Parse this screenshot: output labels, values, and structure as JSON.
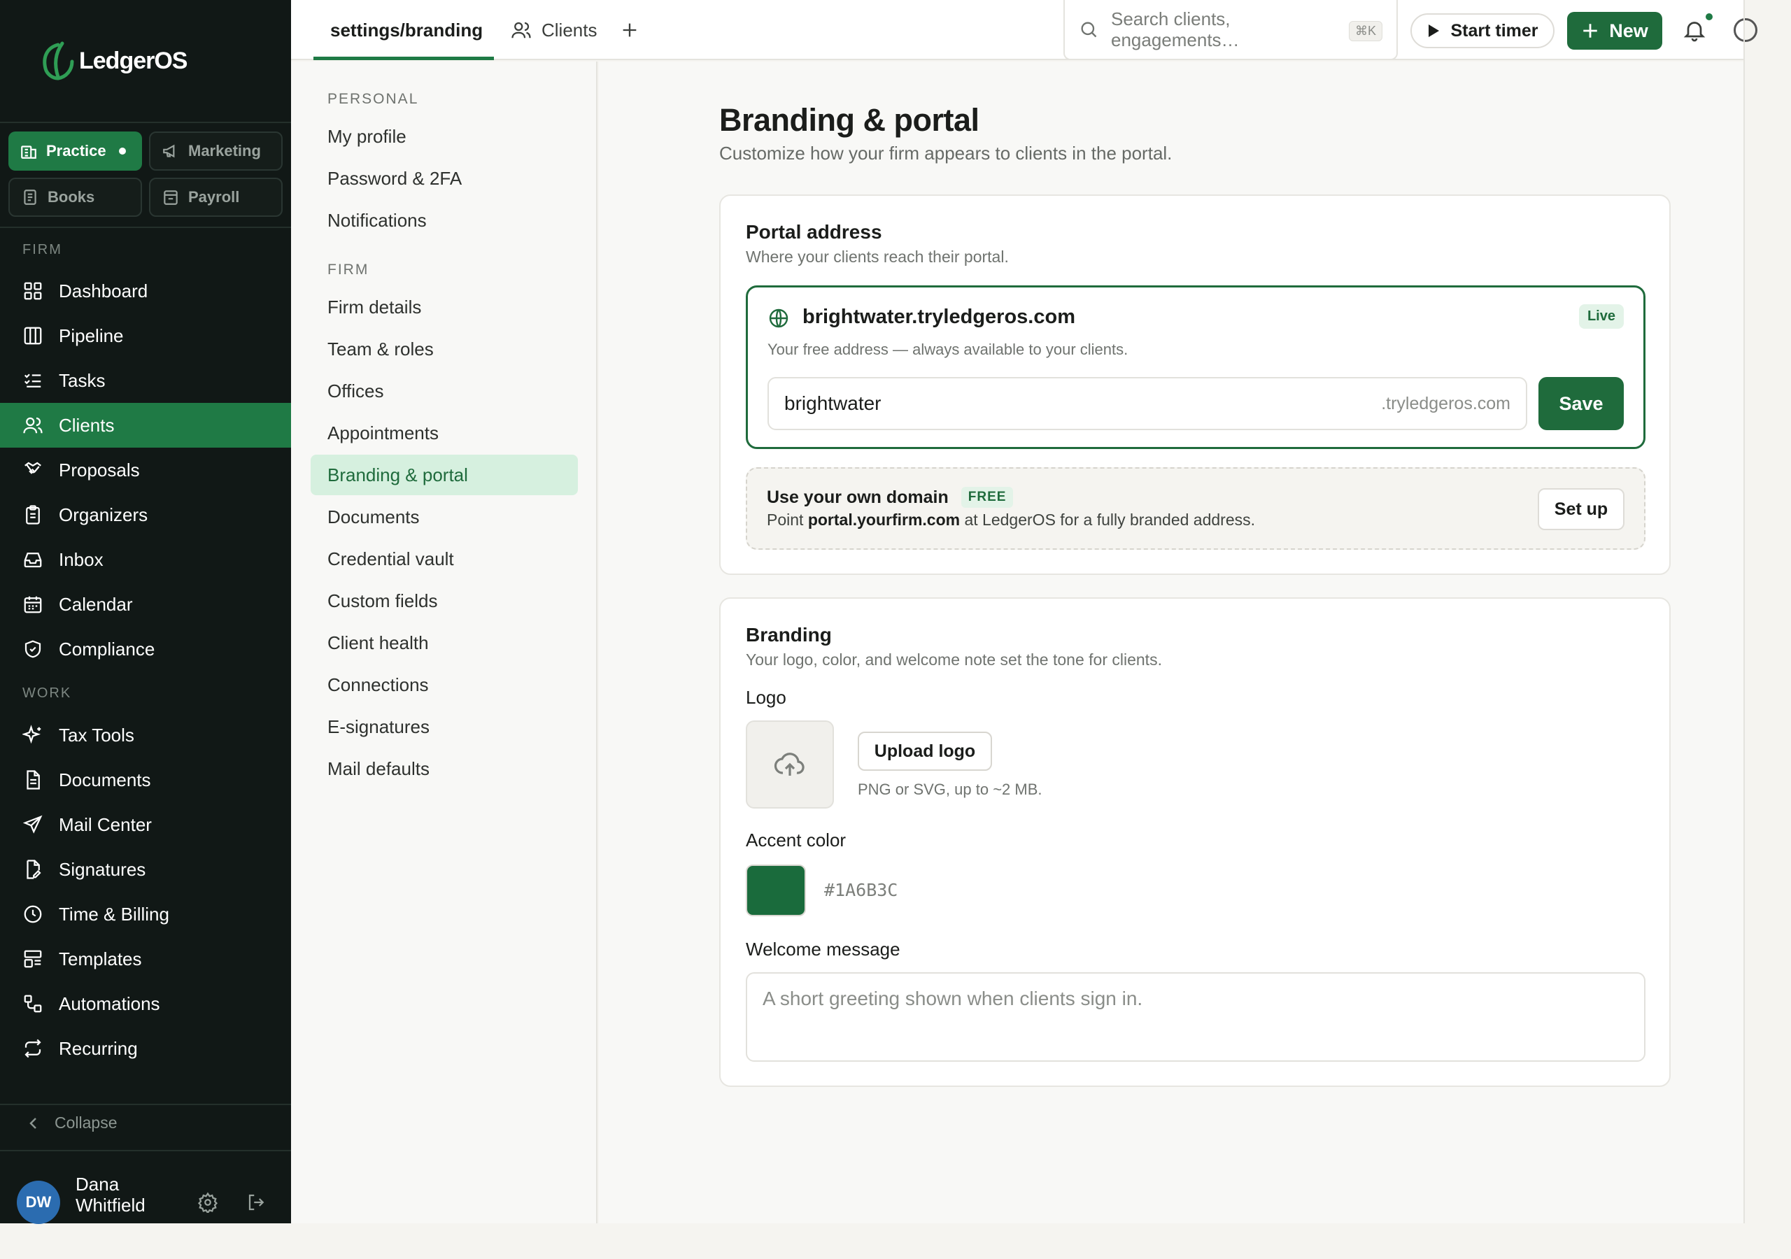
{
  "brand": {
    "name": "LedgerOS",
    "accent": "#1F7A45",
    "sidebar_bg": "#111816"
  },
  "workspaces": [
    {
      "label": "Practice",
      "icon": "building-icon",
      "active": true
    },
    {
      "label": "Marketing",
      "icon": "megaphone-icon",
      "active": false
    },
    {
      "label": "Books",
      "icon": "ledger-icon",
      "active": false
    },
    {
      "label": "Payroll",
      "icon": "payroll-icon",
      "active": false
    }
  ],
  "sidebar": {
    "firm_label": "FIRM",
    "work_label": "WORK",
    "firm_items": [
      {
        "label": "Dashboard",
        "icon": "dashboard-icon"
      },
      {
        "label": "Pipeline",
        "icon": "pipeline-icon"
      },
      {
        "label": "Tasks",
        "icon": "tasks-icon"
      },
      {
        "label": "Clients",
        "icon": "clients-icon",
        "active": true
      },
      {
        "label": "Proposals",
        "icon": "handshake-icon"
      },
      {
        "label": "Organizers",
        "icon": "clipboard-icon"
      },
      {
        "label": "Inbox",
        "icon": "inbox-icon"
      },
      {
        "label": "Calendar",
        "icon": "calendar-icon"
      },
      {
        "label": "Compliance",
        "icon": "shield-icon"
      }
    ],
    "work_items": [
      {
        "label": "Tax Tools",
        "icon": "sparkle-icon"
      },
      {
        "label": "Documents",
        "icon": "document-icon"
      },
      {
        "label": "Mail Center",
        "icon": "send-icon"
      },
      {
        "label": "Signatures",
        "icon": "signature-icon"
      },
      {
        "label": "Time & Billing",
        "icon": "clock-icon"
      },
      {
        "label": "Templates",
        "icon": "template-icon"
      },
      {
        "label": "Automations",
        "icon": "automation-icon"
      },
      {
        "label": "Recurring",
        "icon": "recurring-icon"
      }
    ],
    "collapse_label": "Collapse",
    "user": {
      "initials": "DW",
      "name": "Dana Whitfield",
      "avatar_color": "#2B6CB0"
    }
  },
  "topbar": {
    "tabs": [
      {
        "label": "settings/branding",
        "active": true
      },
      {
        "label": "Clients",
        "icon": "users-icon"
      }
    ],
    "search": {
      "placeholder": "Search clients, engagements…",
      "shortcut": "⌘K"
    },
    "start_timer_label": "Start timer",
    "new_label": "New"
  },
  "settings_menu": {
    "personal_label": "PERSONAL",
    "personal_items": [
      "My profile",
      "Password & 2FA",
      "Notifications"
    ],
    "firm_label": "FIRM",
    "firm_items": [
      "Firm details",
      "Team & roles",
      "Offices",
      "Appointments",
      "Branding & portal",
      "Documents",
      "Credential vault",
      "Custom fields",
      "Client health",
      "Connections",
      "E-signatures",
      "Mail defaults"
    ],
    "active_item": "Branding & portal"
  },
  "page": {
    "title": "Branding & portal",
    "subtitle": "Customize how your firm appears to clients in the portal."
  },
  "portal_address": {
    "title": "Portal address",
    "subtitle": "Where your clients reach their portal.",
    "domain": "brightwater.tryledgeros.com",
    "status": "Live",
    "note": "Your free address — always available to your clients.",
    "subdomain_value": "brightwater",
    "suffix": ".tryledgeros.com",
    "save_label": "Save",
    "custom_domain": {
      "title": "Use your own domain",
      "badge": "FREE",
      "note_prefix": "Point ",
      "note_domain": "portal.yourfirm.com",
      "note_suffix": " at LedgerOS for a fully branded address.",
      "button_label": "Set up"
    }
  },
  "branding": {
    "title": "Branding",
    "subtitle": "Your logo, color, and welcome note set the tone for clients.",
    "logo_label": "Logo",
    "upload_label": "Upload logo",
    "upload_hint": "PNG or SVG, up to ~2 MB.",
    "accent_label": "Accent color",
    "accent_hex": "#1A6B3C",
    "welcome_label": "Welcome message",
    "welcome_placeholder": "A short greeting shown when clients sign in."
  }
}
